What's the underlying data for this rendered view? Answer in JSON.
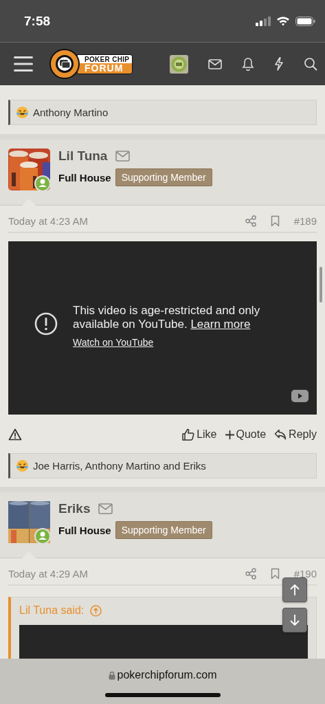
{
  "status_bar": {
    "time": "7:58"
  },
  "nav": {
    "logo_top": "POKER CHIP",
    "logo_bottom": "FORUM"
  },
  "previous_post": {
    "reactions": "Anthony Martino"
  },
  "posts": [
    {
      "author": "Lil Tuna",
      "rank": "Full House",
      "badge": "Supporting Member",
      "online": true,
      "time": "Today at 4:23 AM",
      "number": "#189",
      "video": {
        "message": "This video is age-restricted and only available on YouTube.",
        "link": "Learn more",
        "watch": "Watch on YouTube"
      },
      "actions": [
        {
          "kind": "like",
          "label": "Like"
        },
        {
          "kind": "quote",
          "label": "Quote"
        },
        {
          "kind": "reply",
          "label": "Reply"
        }
      ],
      "reactions": "Joe Harris, Anthony Martino and Eriks"
    },
    {
      "author": "Eriks",
      "rank": "Full House",
      "badge": "Supporting Member",
      "online": true,
      "time": "Today at 4:29 AM",
      "number": "#190",
      "quote": {
        "attribution": "Lil Tuna said:"
      }
    }
  ],
  "address_bar": {
    "url": "pokerchipforum.com"
  }
}
